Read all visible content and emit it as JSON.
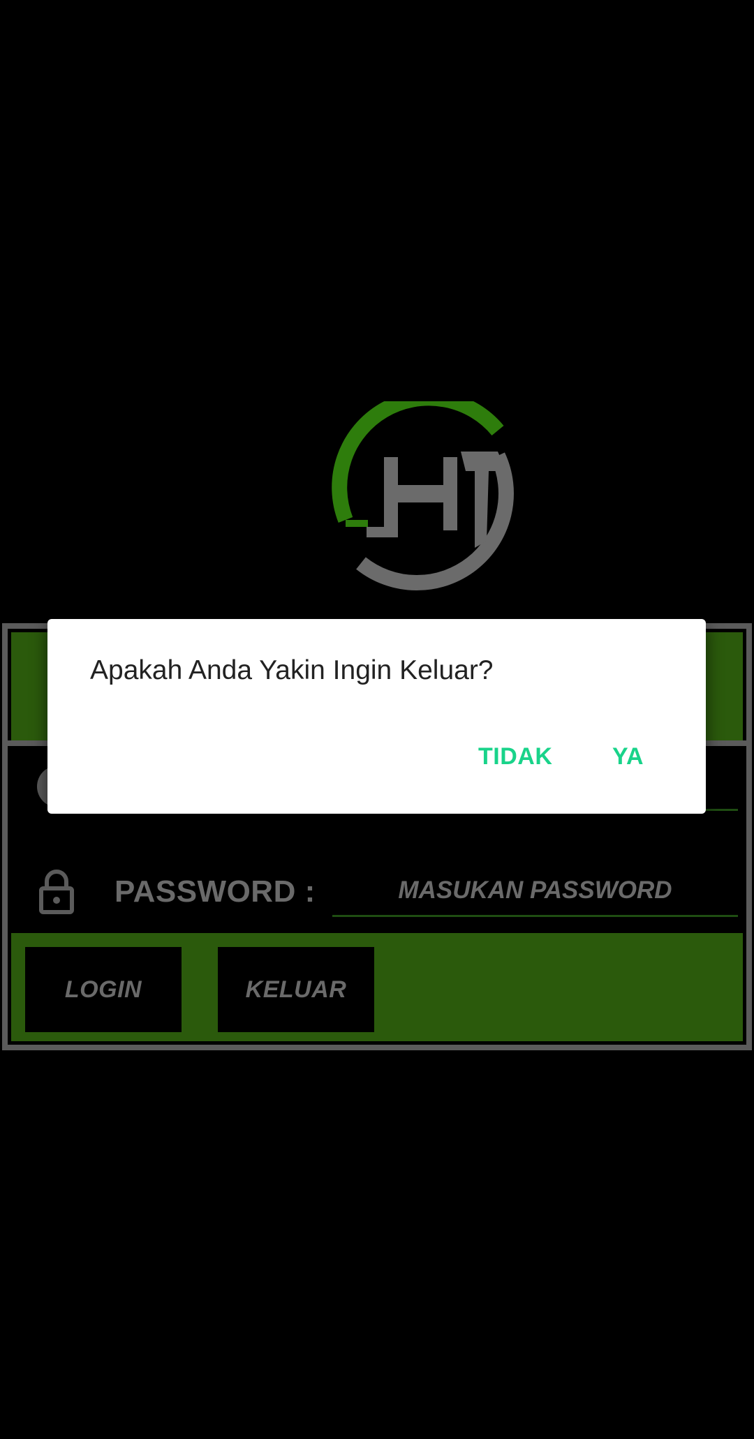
{
  "dialog": {
    "message": "Apakah Anda Yakin Ingin Keluar?",
    "negative_label": "TIDAK",
    "positive_label": "YA",
    "accent_color": "#19d38a"
  },
  "login_form": {
    "password_label": "PASSWORD :",
    "password_placeholder": "MASUKAN PASSWORD",
    "login_button": "LOGIN",
    "exit_button": "KELUAR"
  },
  "colors": {
    "background": "#000000",
    "panel_green": "#2b5a0c",
    "panel_border": "#5b5b5b",
    "logo_green": "#2e7d0c",
    "logo_gray": "#6b6b6b"
  },
  "icons": {
    "logo": "app-logo-jht",
    "password": "lock-icon",
    "username": "user-icon"
  }
}
